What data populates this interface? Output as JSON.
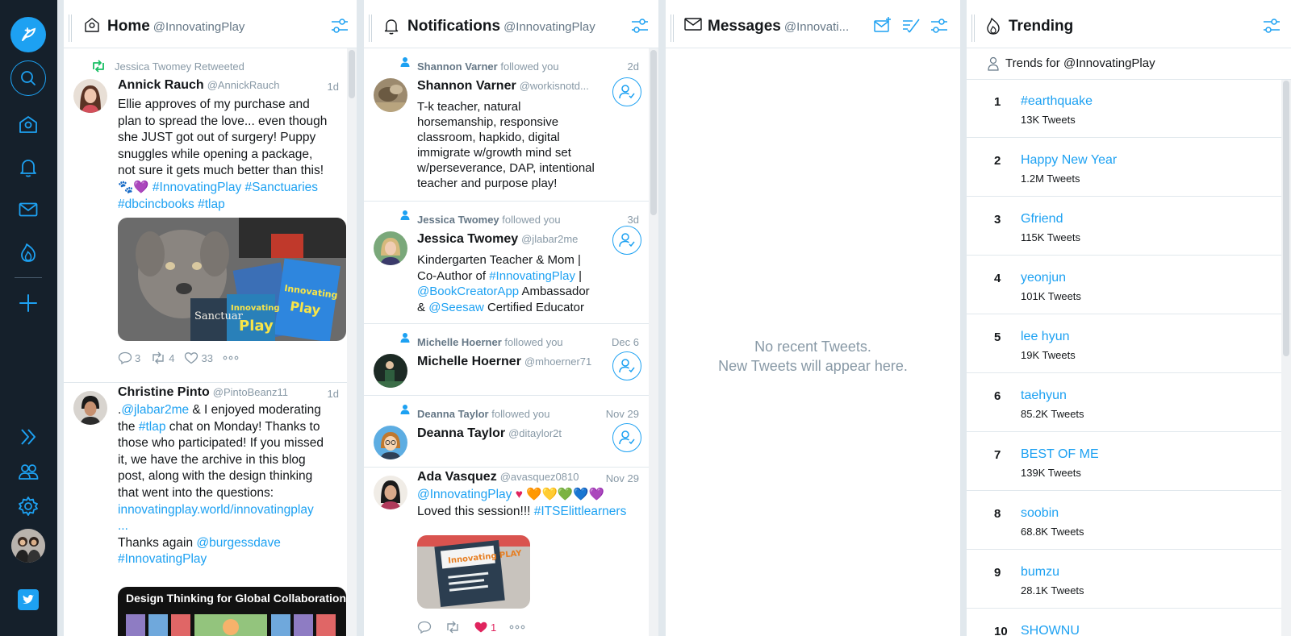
{
  "columns": {
    "home": {
      "number": "1",
      "title": "Home",
      "account": "@InnovatingPlay"
    },
    "notifications": {
      "number": "2",
      "title": "Notifications",
      "account": "@InnovatingPlay"
    },
    "messages": {
      "number": "3",
      "title": "Messages",
      "account": "@Innovati..."
    },
    "trending": {
      "number": "4",
      "title": "Trending",
      "trends_for": "Trends for @InnovatingPlay"
    }
  },
  "home_tweets": [
    {
      "retweeted_by": "Jessica Twomey Retweeted",
      "name": "Annick Rauch",
      "handle": "@AnnickRauch",
      "time": "1d",
      "text_line1": "Ellie approves of my purchase and",
      "text_line2": "plan to spread the love... even though",
      "text_line3": "she JUST got out of surgery! Puppy",
      "text_line4": "snuggles while opening a package,",
      "text_line5": "not sure it gets much better than this!",
      "emoji": "🐾💜",
      "hashtag1": "#InnovatingPlay",
      "hashtag2": "#Sanctuaries",
      "hashtag3": "#dbcincbooks",
      "hashtag4": "#tlap",
      "replies": "3",
      "retweets": "4",
      "likes": "33",
      "image_text": {
        "book1": "Sanctuar",
        "book2": "Innovating",
        "book3": "Play",
        "book4": "Innovating",
        "book5": "Play",
        "book6": "Innovating",
        "book7": "Play"
      }
    },
    {
      "name": "Christine Pinto",
      "handle": "@PintoBeanz11",
      "time": "1d",
      "mention1": "@jlabar2me",
      "t1": " & I enjoyed moderating",
      "t2a": "the ",
      "hashtag1": "#tlap",
      "t2b": " chat on Monday! Thanks to",
      "t3": "those who participated! If you missed",
      "t4": "it, we have the archive in this blog",
      "t5": "post, along with the design thinking",
      "t6": "that went into the questions:",
      "link": "innovatingplay.world/innovatingplay",
      "link_cont": "...",
      "t7": "Thanks again ",
      "mention2": "@burgessdave",
      "hashtag2": "#InnovatingPlay",
      "image_title": "Design Thinking for Global Collaboration"
    }
  ],
  "notifications": [
    {
      "header_name": "Shannon Varner",
      "header_action": "followed you",
      "time": "2d",
      "name": "Shannon Varner",
      "handle": "@workisnotd...",
      "bio": [
        "T-k teacher, natural",
        "horsemanship, responsive",
        "classroom, hapkido, digital",
        "immigrate w/growth mind set",
        "w/perseverance, DAP, intentional",
        "teacher and purpose play!"
      ]
    },
    {
      "header_name": "Jessica Twomey",
      "header_action": "followed you",
      "time": "3d",
      "name": "Jessica Twomey",
      "handle": "@jlabar2me",
      "bio1": "Kindergarten Teacher & Mom |",
      "bio2a": "Co-Author of ",
      "bio2_tag": "#InnovatingPlay",
      "bio2b": " |",
      "bio3_tag": "@BookCreatorApp",
      "bio3b": " Ambassador",
      "bio4a": "& ",
      "bio4_tag": "@Seesaw",
      "bio4b": " Certified Educator"
    },
    {
      "header_name": "Michelle Hoerner",
      "header_action": "followed you",
      "time": "Dec 6",
      "name": "Michelle Hoerner",
      "handle": "@mhoerner71"
    },
    {
      "header_name": "Deanna Taylor",
      "header_action": "followed you",
      "time": "Nov 29",
      "name": "Deanna Taylor",
      "handle": "@ditaylor2t"
    },
    {
      "name": "Ada Vasquez",
      "handle": "@avasquez0810",
      "time": "Nov 29",
      "mention": "@InnovatingPlay",
      "hearts": "♥ 🧡💛💚💙💜",
      "t2a": "Loved this session!!! ",
      "t2_tag": "#ITSElittlearners",
      "likes": "1",
      "image_text": "Innovating PLAY"
    }
  ],
  "messages": {
    "empty_line1": "No recent Tweets.",
    "empty_line2": "New Tweets will appear here."
  },
  "trends": [
    {
      "rank": "1",
      "name": "#earthquake",
      "count": "13K Tweets"
    },
    {
      "rank": "2",
      "name": "Happy New Year",
      "count": "1.2M Tweets"
    },
    {
      "rank": "3",
      "name": "Gfriend",
      "count": "115K Tweets"
    },
    {
      "rank": "4",
      "name": "yeonjun",
      "count": "101K Tweets"
    },
    {
      "rank": "5",
      "name": "lee hyun",
      "count": "19K Tweets"
    },
    {
      "rank": "6",
      "name": "taehyun",
      "count": "85.2K Tweets"
    },
    {
      "rank": "7",
      "name": "BEST OF ME",
      "count": "139K Tweets"
    },
    {
      "rank": "8",
      "name": "soobin",
      "count": "68.8K Tweets"
    },
    {
      "rank": "9",
      "name": "bumzu",
      "count": "28.1K Tweets"
    },
    {
      "rank": "10",
      "name": "SHOWNU",
      "count": ""
    }
  ],
  "colors": {
    "accent": "#1da1f2",
    "nav_bg": "#15202b",
    "retweet_green": "#17bf63",
    "like_red": "#e0245e"
  }
}
